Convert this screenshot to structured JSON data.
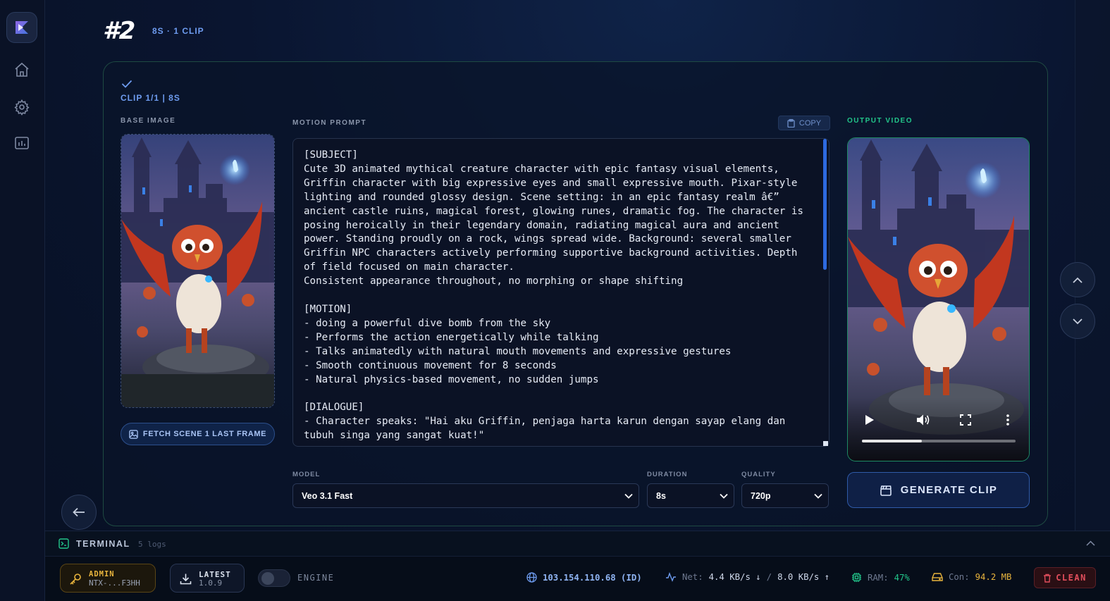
{
  "header": {
    "number": "#2",
    "subtitle": "8S · 1 CLIP"
  },
  "clip": {
    "label": "CLIP 1/1 | 8S"
  },
  "base_image": {
    "label": "BASE IMAGE",
    "fetch_label": "FETCH SCENE 1 LAST FRAME"
  },
  "motion_prompt": {
    "label": "MOTION PROMPT",
    "copy_label": "COPY",
    "text": "[SUBJECT]\nCute 3D animated mythical creature character with epic fantasy visual elements, Griffin character with big expressive eyes and small expressive mouth. Pixar-style lighting and rounded glossy design. Scene setting: in an epic fantasy realm â€” ancient castle ruins, magical forest, glowing runes, dramatic fog. The character is posing heroically in their legendary domain, radiating magical aura and ancient power. Standing proudly on a rock, wings spread wide. Background: several smaller Griffin NPC characters actively performing supportive background activities. Depth of field focused on main character.\nConsistent appearance throughout, no morphing or shape shifting\n\n[MOTION]\n- doing a powerful dive bomb from the sky\n- Performs the action energetically while talking\n- Talks animatedly with natural mouth movements and expressive gestures\n- Smooth continuous movement for 8 seconds\n- Natural physics-based movement, no sudden jumps\n\n[DIALOGUE]\n- Character speaks: \"Hai aku Griffin, penjaga harta karun dengan sayap elang dan tubuh singa yang sangat kuat!\""
  },
  "model": {
    "label": "MODEL",
    "value": "Veo 3.1 Fast"
  },
  "duration": {
    "label": "DURATION",
    "value": "8s"
  },
  "quality": {
    "label": "QUALITY",
    "value": "720p"
  },
  "output": {
    "label": "OUTPUT VIDEO",
    "progress": 0.39
  },
  "generate": {
    "label": "GENERATE CLIP"
  },
  "terminal": {
    "title": "TERMINAL",
    "count": "5 logs"
  },
  "status": {
    "admin_role": "ADMIN",
    "admin_id": "NTX-...F3HH",
    "latest_label": "LATEST",
    "version": "1.0.9",
    "engine_label": "ENGINE",
    "ip": "103.154.110.68 (ID)",
    "net_label": "Net:",
    "net_down": "4.4 KB/s ↓",
    "net_sep": "/",
    "net_up": "8.0 KB/s ↑",
    "ram_label": "RAM:",
    "ram_value": "47%",
    "con_label": "Con:",
    "con_value": "94.2 MB",
    "clean_label": "CLEAN"
  },
  "colors": {
    "accent": "#6e9cf0",
    "success": "#22c58a",
    "warning": "#e8b43d",
    "danger": "#e24e5c"
  }
}
